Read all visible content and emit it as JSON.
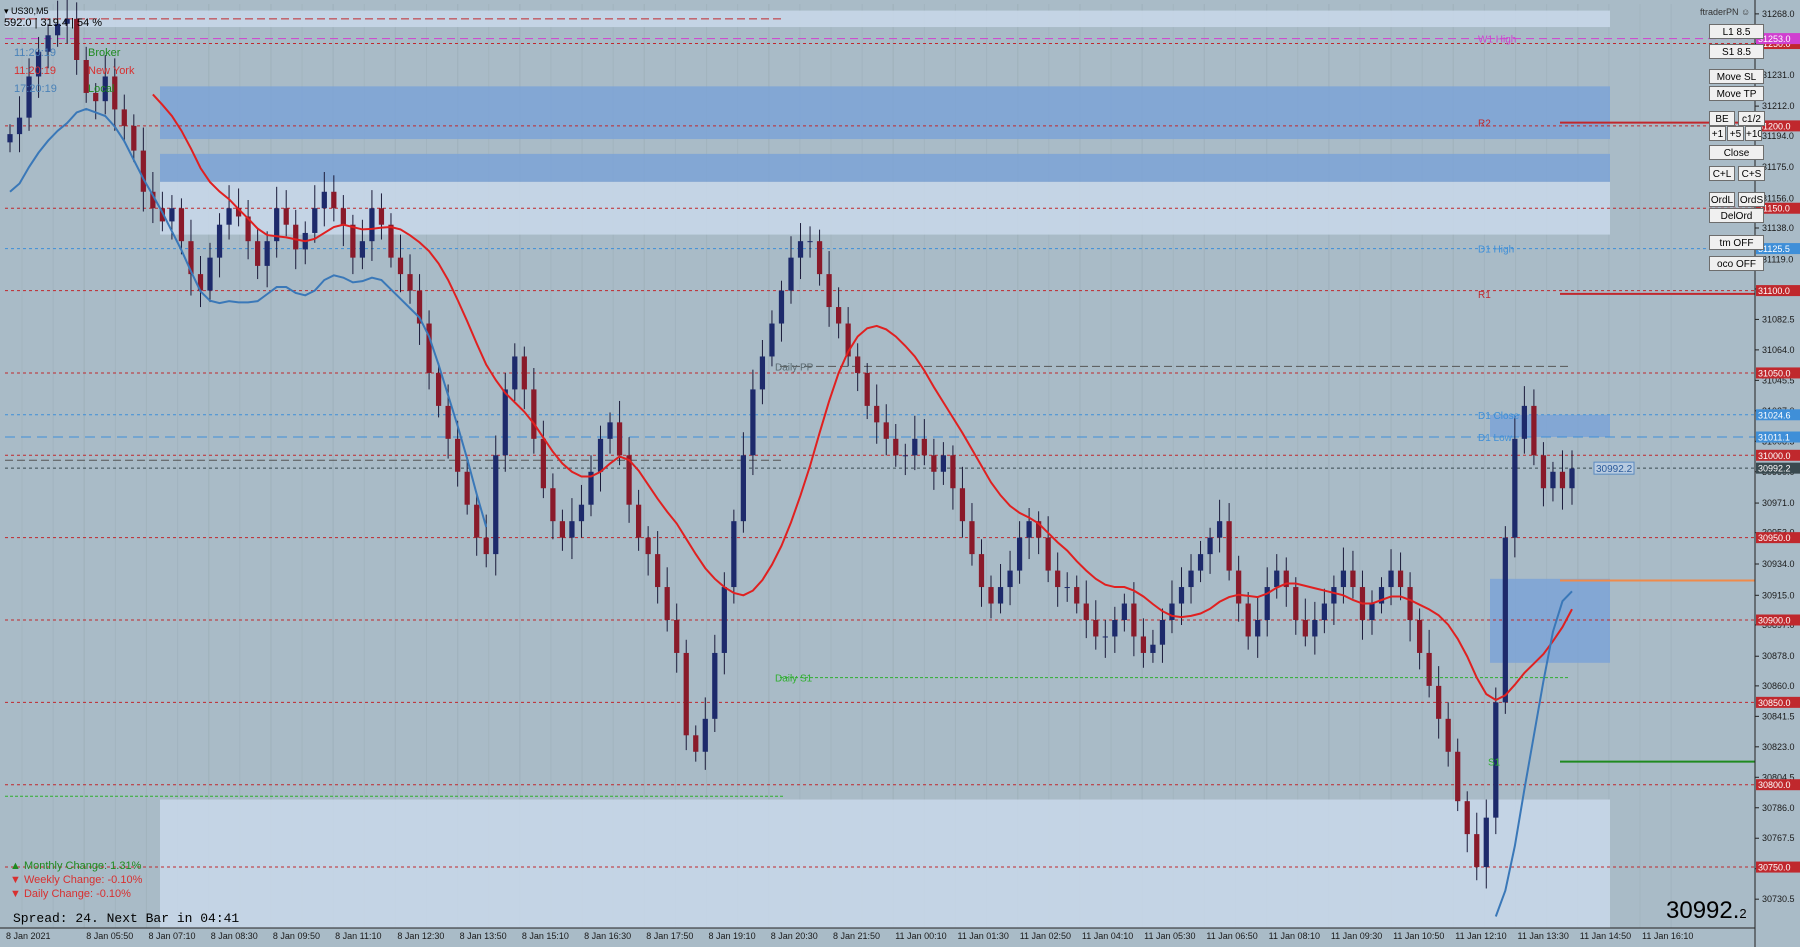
{
  "header": {
    "symbol": "US30,M5",
    "stats": "592.0 | 319.4 | 54 %",
    "brand": "ftraderPN"
  },
  "clocks": [
    {
      "time": "11:20:19",
      "label": "Broker",
      "time_color": "#4a82b8",
      "label_color": "#1f8a1f"
    },
    {
      "time": "11:20:19",
      "label": "New York",
      "time_color": "#d83030",
      "label_color": "#d83030"
    },
    {
      "time": "17:20:19",
      "label": "Local",
      "time_color": "#4a82b8",
      "label_color": "#1f8a1f"
    }
  ],
  "buttons": [
    {
      "label": "L1 8.5"
    },
    {
      "label": "S1 8.5"
    },
    {
      "label": "Move SL"
    },
    {
      "label": "Move TP"
    },
    {
      "label": "BE"
    },
    {
      "label": "c1/2"
    },
    {
      "label": "+1"
    },
    {
      "label": "+5"
    },
    {
      "label": "+10"
    },
    {
      "label": "Close"
    },
    {
      "label": "C+L"
    },
    {
      "label": "C+S"
    },
    {
      "label": "OrdL"
    },
    {
      "label": "OrdS"
    },
    {
      "label": "DelOrd"
    },
    {
      "label": "tm OFF"
    },
    {
      "label": "oco OFF"
    }
  ],
  "changes": [
    {
      "arrow": "▲",
      "text": "Monthly Change: 1.31%",
      "color": "#1f8a1f"
    },
    {
      "arrow": "▼",
      "text": "Weekly Change: -0.10%",
      "color": "#d83030"
    },
    {
      "arrow": "▼",
      "text": "Daily Change: -0.10%",
      "color": "#d83030"
    }
  ],
  "spread_text": "Spread: 24. Next Bar in 04:41",
  "price_big": "30992.",
  "price_big_small": "2",
  "chart_data": {
    "type": "candlestick",
    "symbol": "US30",
    "timeframe": "M5",
    "ylim": [
      30713,
      31274
    ],
    "y_ticks": [
      31268.0,
      31250.0,
      31231.0,
      31212.0,
      31194.0,
      31175.0,
      31156.0,
      31138.0,
      31119.0,
      31101.0,
      31082.5,
      31064.0,
      31045.5,
      31027.0,
      31008.5,
      30990.0,
      30971.0,
      30953.0,
      30934.0,
      30915.0,
      30897.0,
      30878.0,
      30860.0,
      30841.5,
      30823.0,
      30804.5,
      30786.0,
      30767.5,
      30749.0,
      30730.5
    ],
    "x_labels": [
      "8 Jan 2021",
      "8 Jan 05:50",
      "8 Jan 07:10",
      "8 Jan 08:30",
      "8 Jan 09:50",
      "8 Jan 11:10",
      "8 Jan 12:30",
      "8 Jan 13:50",
      "8 Jan 15:10",
      "8 Jan 16:30",
      "8 Jan 17:50",
      "8 Jan 19:10",
      "8 Jan 20:30",
      "8 Jan 21:50",
      "11 Jan 00:10",
      "11 Jan 01:30",
      "11 Jan 02:50",
      "11 Jan 04:10",
      "11 Jan 05:30",
      "11 Jan 06:50",
      "11 Jan 08:10",
      "11 Jan 09:30",
      "11 Jan 10:50",
      "11 Jan 12:10",
      "11 Jan 13:30",
      "11 Jan 14:50",
      "11 Jan 16:10"
    ],
    "price_levels": [
      {
        "value": 31250.0,
        "label": "31250.0",
        "color": "#c0282d"
      },
      {
        "value": 31200.0,
        "label": "31200.0",
        "color": "#c0282d"
      },
      {
        "value": 31150.0,
        "label": "31150.0",
        "color": "#c0282d"
      },
      {
        "value": 31100.0,
        "label": "31100.0",
        "color": "#c0282d"
      },
      {
        "value": 31050.0,
        "label": "31050.0",
        "color": "#c0282d"
      },
      {
        "value": 31000.0,
        "label": "31000.0",
        "color": "#c0282d"
      },
      {
        "value": 30950.0,
        "label": "30950.0",
        "color": "#c0282d"
      },
      {
        "value": 30900.0,
        "label": "30900.0",
        "color": "#c0282d"
      },
      {
        "value": 30850.0,
        "label": "30850.0",
        "color": "#c0282d"
      },
      {
        "value": 30800.0,
        "label": "30800.0",
        "color": "#c0282d"
      },
      {
        "value": 30750.0,
        "label": "30750.0",
        "color": "#c0282d"
      },
      {
        "value": 31125.5,
        "label": "31125.5",
        "color": "#3f8fd8"
      },
      {
        "value": 31024.6,
        "label": "31024.6",
        "color": "#3f8fd8"
      },
      {
        "value": 31011.1,
        "label": "31011.1",
        "color": "#3f8fd8"
      },
      {
        "value": 30992.2,
        "label": "30992.2",
        "color": "#3a4a50"
      },
      {
        "value": 31253.0,
        "label": "31253.0",
        "color": "#d040d0"
      }
    ],
    "annotations": [
      {
        "text": "W1 High",
        "value": 31253.0,
        "color": "#d040d0"
      },
      {
        "text": "R2",
        "value": 31202.0,
        "color": "#c0282d"
      },
      {
        "text": "D1 High",
        "value": 31125.5,
        "color": "#3f8fd8"
      },
      {
        "text": "R1",
        "value": 31098.0,
        "color": "#c0282d"
      },
      {
        "text": "Daily PP",
        "value": 31054.0,
        "color": "#5a6a70"
      },
      {
        "text": "D1 Close",
        "value": 31024.6,
        "color": "#3f8fd8"
      },
      {
        "text": "D1 Low",
        "value": 31011.1,
        "color": "#3f8fd8"
      },
      {
        "text": "Daily S1",
        "value": 30865.0,
        "color": "#2faf2f"
      },
      {
        "text": "S1",
        "value": 30814.0,
        "color": "#2faf2f"
      }
    ],
    "current_price": 30992.2,
    "close_series": [
      31195,
      31205,
      31230,
      31245,
      31255,
      31262,
      31265,
      31240,
      31220,
      31215,
      31230,
      31210,
      31200,
      31185,
      31160,
      31150,
      31142,
      31150,
      31130,
      31110,
      31100,
      31120,
      31140,
      31150,
      31145,
      31130,
      31115,
      31130,
      31150,
      31140,
      31125,
      31135,
      31150,
      31160,
      31150,
      31140,
      31120,
      31130,
      31150,
      31140,
      31120,
      31110,
      31100,
      31080,
      31050,
      31030,
      31010,
      30990,
      30970,
      30950,
      30940,
      31000,
      31040,
      31060,
      31040,
      31010,
      30980,
      30960,
      30950,
      30960,
      30970,
      30990,
      31010,
      31020,
      31000,
      30970,
      30950,
      30940,
      30920,
      30900,
      30880,
      30830,
      30820,
      30840,
      30880,
      30920,
      30960,
      31000,
      31040,
      31060,
      31080,
      31100,
      31120,
      31130,
      31130,
      31110,
      31090,
      31080,
      31060,
      31050,
      31030,
      31020,
      31010,
      31000,
      31000,
      31010,
      31000,
      30990,
      31000,
      30980,
      30960,
      30940,
      30920,
      30910,
      30920,
      30930,
      30950,
      30960,
      30950,
      30930,
      30920,
      30920,
      30910,
      30900,
      30890,
      30890,
      30900,
      30910,
      30890,
      30880,
      30885,
      30900,
      30910,
      30920,
      30930,
      30940,
      30950,
      30960,
      30930,
      30910,
      30890,
      30900,
      30920,
      30930,
      30920,
      30900,
      30890,
      30900,
      30910,
      30920,
      30930,
      30920,
      30900,
      30910,
      30920,
      30930,
      30920,
      30900,
      30880,
      30860,
      30840,
      30820,
      30790,
      30770,
      30750,
      30780,
      30850,
      30950,
      31010,
      31030,
      31000,
      30980,
      30990,
      30980,
      30992
    ]
  }
}
